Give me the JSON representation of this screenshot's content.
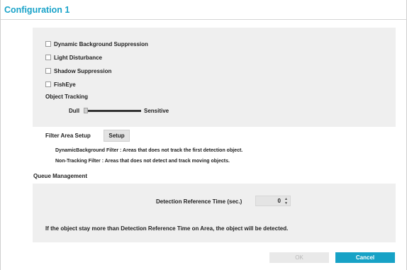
{
  "dialog": {
    "title": "Configuration 1"
  },
  "options": [
    {
      "label": "Dynamic Background Suppression",
      "checked": false
    },
    {
      "label": "Light Disturbance",
      "checked": false
    },
    {
      "label": "Shadow Suppression",
      "checked": false
    },
    {
      "label": "FishEye",
      "checked": false
    }
  ],
  "object_tracking": {
    "label": "Object Tracking",
    "min_label": "Dull",
    "max_label": "Sensitive",
    "level": 0
  },
  "filter_area": {
    "label": "Filter Area Setup",
    "setup_button": "Setup",
    "note_dynamic": "DynamicBackground Filter : Areas that does not track the first detection object.",
    "note_non_tracking": "Non-Tracking Filter : Areas that does not detect and track moving objects."
  },
  "queue_management": {
    "label": "Queue Management",
    "detection_time_label": "Detection Reference Time (sec.)",
    "detection_time_value": "0",
    "description": "If the object stay more than Detection Reference Time on Area, the object will be detected."
  },
  "footer": {
    "ok_label": "OK",
    "cancel_label": "Cancel"
  },
  "colors": {
    "accent": "#17a2c6",
    "panel_bg": "#efefef"
  }
}
